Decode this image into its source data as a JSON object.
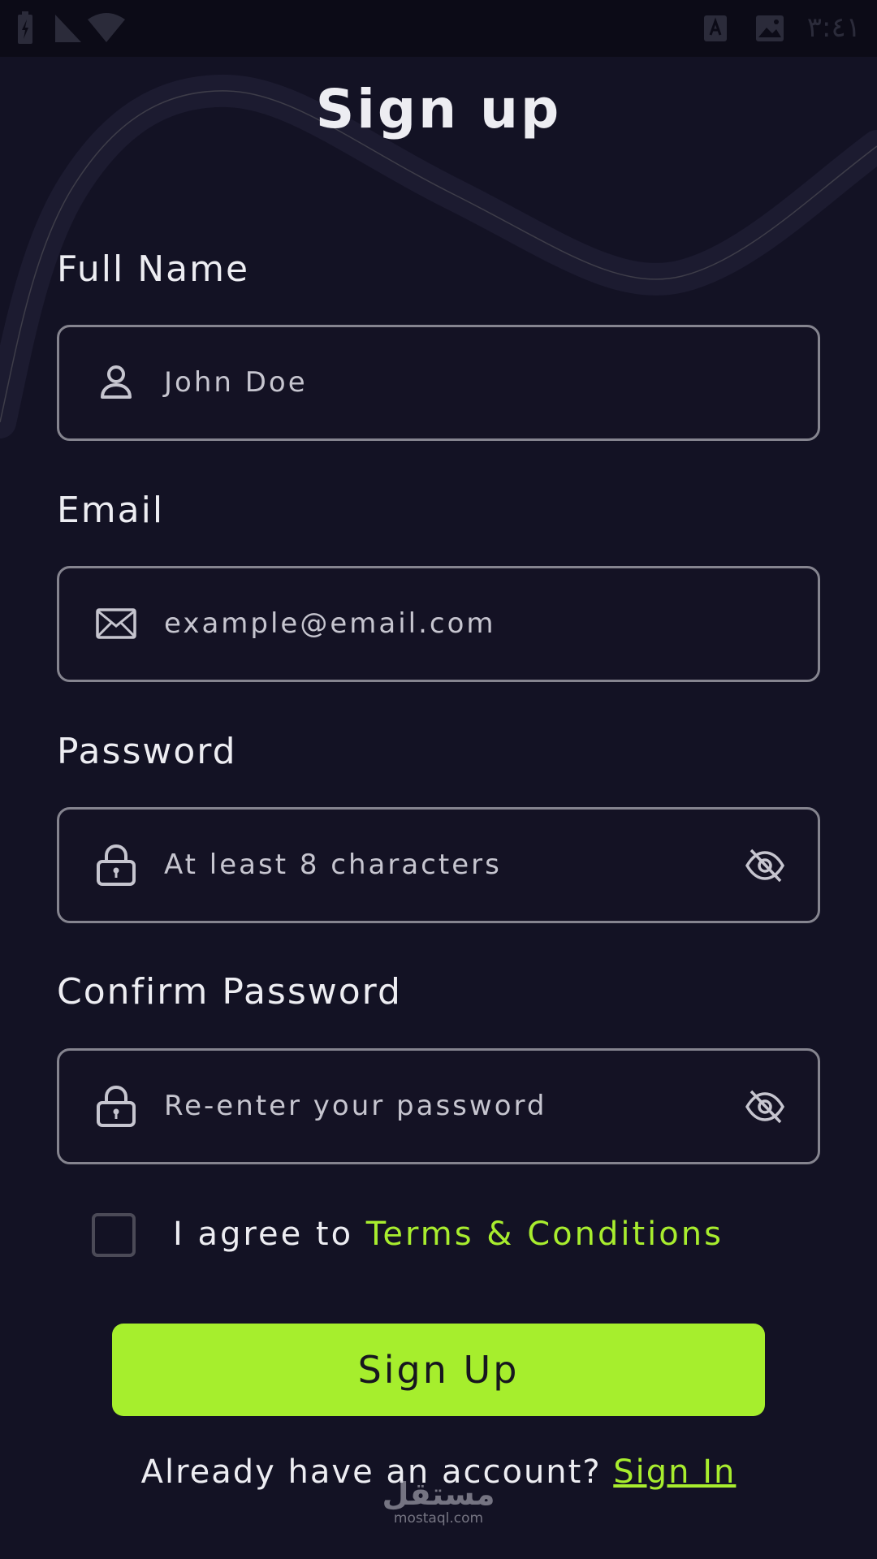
{
  "status_bar": {
    "time": "٣:٤١",
    "icons": [
      "battery-charging-icon",
      "cellular-signal-icon",
      "wifi-icon",
      "app-notification-icon",
      "image-notification-icon"
    ]
  },
  "title": "Sign up",
  "fields": [
    {
      "label": "Full Name",
      "value": "John Doe",
      "icon": "person-icon"
    },
    {
      "label": "Email",
      "value": "example@email.com",
      "icon": "mail-icon"
    },
    {
      "label": "Password",
      "value": "At least 8 characters",
      "icon": "lock-icon",
      "trailing_icon": "eye-off-icon"
    },
    {
      "label": "Confirm Password",
      "value": "Re-enter your password",
      "icon": "lock-icon",
      "trailing_icon": "eye-off-icon"
    }
  ],
  "agree": {
    "text": "I agree to ",
    "link": "Terms & Conditions",
    "checked": false
  },
  "signup_button": "Sign Up",
  "footer": {
    "text": "Already have an account? ",
    "link": "Sign In"
  },
  "watermark": {
    "arabic": "مستقل",
    "domain": "mostaql.com"
  },
  "colors": {
    "background": "#131224",
    "accent": "#a6ee2d",
    "field_border": "#85848f",
    "text": "#ededf2"
  }
}
